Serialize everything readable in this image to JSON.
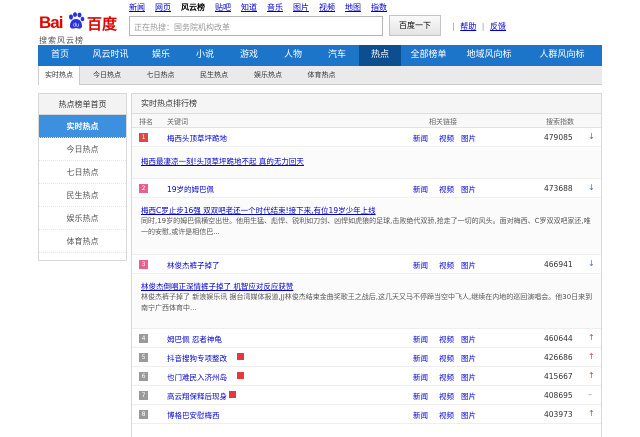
{
  "logo": {
    "bai": "Bai",
    "du": "百度",
    "paw_text": "du",
    "subtitle": "搜索风云榜"
  },
  "topnav": [
    {
      "label": "新闻",
      "current": false
    },
    {
      "label": "网页",
      "current": false
    },
    {
      "label": "风云榜",
      "current": true
    },
    {
      "label": "贴吧",
      "current": false
    },
    {
      "label": "知道",
      "current": false
    },
    {
      "label": "音乐",
      "current": false
    },
    {
      "label": "图片",
      "current": false
    },
    {
      "label": "视频",
      "current": false
    },
    {
      "label": "地图",
      "current": false
    },
    {
      "label": "指数",
      "current": false
    }
  ],
  "search": {
    "placeholder": "正在热搜：国务院机构改革",
    "button": "百度一下",
    "help": "帮助",
    "feedback": "反馈"
  },
  "mainnav": [
    {
      "label": "首页",
      "w": 44
    },
    {
      "label": "风云时讯",
      "w": 57
    },
    {
      "label": "娱乐",
      "w": 44
    },
    {
      "label": "小说",
      "w": 44
    },
    {
      "label": "游戏",
      "w": 44
    },
    {
      "label": "人物",
      "w": 44
    },
    {
      "label": "汽车",
      "w": 44
    },
    {
      "label": "热点",
      "w": 42,
      "active": true
    },
    {
      "label": "全部榜单",
      "w": 55
    },
    {
      "label": "地域风向标",
      "w": 66
    },
    {
      "label": "人群风向标",
      "w": 80
    }
  ],
  "subnav": [
    {
      "label": "实时热点",
      "active": true
    },
    {
      "label": "今日热点"
    },
    {
      "label": "七日热点"
    },
    {
      "label": "民生热点"
    },
    {
      "label": "娱乐热点"
    },
    {
      "label": "体育热点"
    }
  ],
  "sidebar": {
    "heading": "热点榜单首页",
    "items": [
      {
        "label": "实时热点",
        "active": true
      },
      {
        "label": "今日热点"
      },
      {
        "label": "七日热点"
      },
      {
        "label": "民生热点"
      },
      {
        "label": "娱乐热点"
      },
      {
        "label": "体育热点"
      }
    ]
  },
  "panel": {
    "title": "实时热点排行榜",
    "headers": {
      "rank": "排名",
      "keyword": "关键词",
      "links": "相关链接",
      "index": "搜索指数"
    }
  },
  "links": {
    "news": "新闻",
    "video": "视频",
    "image": "图片"
  },
  "colors": {
    "red_rank": "#e24444",
    "pink_rank": "#e8608b",
    "gray_rank": "#9a9a9a",
    "up": "#e23b3b",
    "down": "#3b6fe0",
    "nav_blue": "#1c75c8"
  },
  "rows": [
    {
      "rank": "1",
      "name": "梅西头顶草坪跪地",
      "index": "479085",
      "trend": "down"
    },
    {
      "rank": "2",
      "name": "19岁的姆巴佩",
      "index": "473688",
      "trend": "down"
    },
    {
      "rank": "3",
      "name": "林俊杰裤子掉了",
      "index": "466941",
      "trend": "down"
    },
    {
      "rank": "4",
      "name": "姆巴佩 忍者神龟",
      "index": "460644",
      "trend": "up"
    },
    {
      "rank": "5",
      "name": "抖音搜狗专项整改",
      "index": "426686",
      "trend": "up",
      "hot": true
    },
    {
      "rank": "6",
      "name": "也门难民入济州岛",
      "index": "415667",
      "trend": "up",
      "hot": true
    },
    {
      "rank": "7",
      "name": "高云翔保释后现身",
      "index": "408695",
      "trend": "flat",
      "hot": true
    },
    {
      "rank": "8",
      "name": "博格巴安慰梅西",
      "index": "403973",
      "trend": "up"
    }
  ],
  "details": [
    {
      "title": "梅西最凄凉一刻!头顶草坪跪地不起 真的无力回天",
      "text": ""
    },
    {
      "title": "梅西C罗止步16强 双双吧老还一个时代结束!接下来,有位19岁少年上线",
      "text": "同时,19岁的姆巴佩横空出世。他用生猛、彪悍、锐利如刀剑、凶悍如虎狼的足球,击败绝代双骄,抢走了一切的风头。面对梅西、C罗双双吧家还,唯一的安慰,或许是相信巴..."
    },
    {
      "title": "林俊杰倒唱正深情裤子掉了 机智应对反应获赞",
      "text": "林俊杰裤子掉了 新浪娱乐讯 据台湾媒体报道,JJ林俊杰结束金曲奖歌王之战后,这几天又马不停蹄当空中飞人,继续在内地的巡回演唱会。他30日来到南宁广西体育中..."
    }
  ]
}
